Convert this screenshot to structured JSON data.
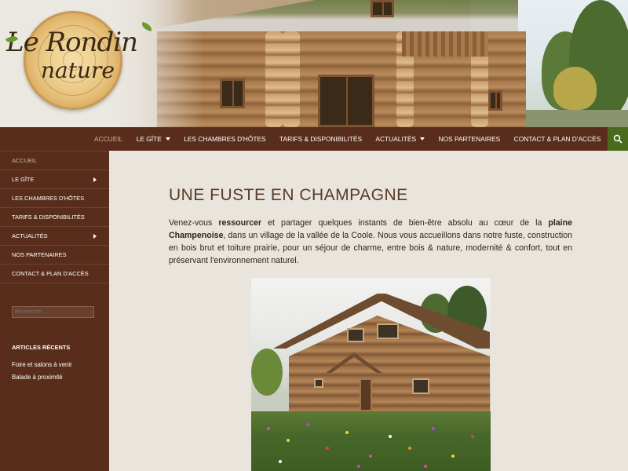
{
  "site": {
    "logo_line1": "Le Rondin",
    "logo_line2": "nature"
  },
  "nav": {
    "items": [
      {
        "label": "Accueil",
        "active": true,
        "dropdown": false
      },
      {
        "label": "Le gîte",
        "active": false,
        "dropdown": true
      },
      {
        "label": "Les chambres d'hôtes",
        "active": false,
        "dropdown": false
      },
      {
        "label": "Tarifs & disponibilités",
        "active": false,
        "dropdown": false
      },
      {
        "label": "Actualités",
        "active": false,
        "dropdown": true
      },
      {
        "label": "Nos partenaires",
        "active": false,
        "dropdown": false
      },
      {
        "label": "Contact & plan d'accès",
        "active": false,
        "dropdown": false
      }
    ],
    "search_icon": "search-icon"
  },
  "sidebar": {
    "items": [
      {
        "label": "Accueil",
        "active": true,
        "submenu": false
      },
      {
        "label": "Le gîte",
        "active": false,
        "submenu": true
      },
      {
        "label": "Les chambres d'hôtes",
        "active": false,
        "submenu": false
      },
      {
        "label": "Tarifs & disponibilités",
        "active": false,
        "submenu": false
      },
      {
        "label": "Actualités",
        "active": false,
        "submenu": true
      },
      {
        "label": "Nos partenaires",
        "active": false,
        "submenu": false
      },
      {
        "label": "Contact & plan d'accès",
        "active": false,
        "submenu": false
      }
    ],
    "search_placeholder": "Recherche…",
    "recent_heading": "Articles récents",
    "recent_posts": [
      "Foire et salons à venir",
      "Balade à proximité"
    ]
  },
  "main": {
    "title": "Une fuste en Champagne",
    "intro_parts": {
      "p1": "Venez-vous ",
      "b1": "ressourcer",
      "p2": " et partager quelques instants de bien-être absolu au cœur de la ",
      "b2": "plaine Champenoise",
      "p3": ", dans un village de la vallée de la Coole. Nous vous accueillons dans notre fuste, construction en bois brut et toiture prairie, pour un séjour de charme, entre bois & nature, modernité & confort, tout en préservant l'environnement naturel."
    }
  },
  "colors": {
    "nav_bg": "#592d1b",
    "search_bg": "#4a6b1e",
    "content_bg": "#e9e4dc",
    "title_color": "#5a3a2a"
  }
}
